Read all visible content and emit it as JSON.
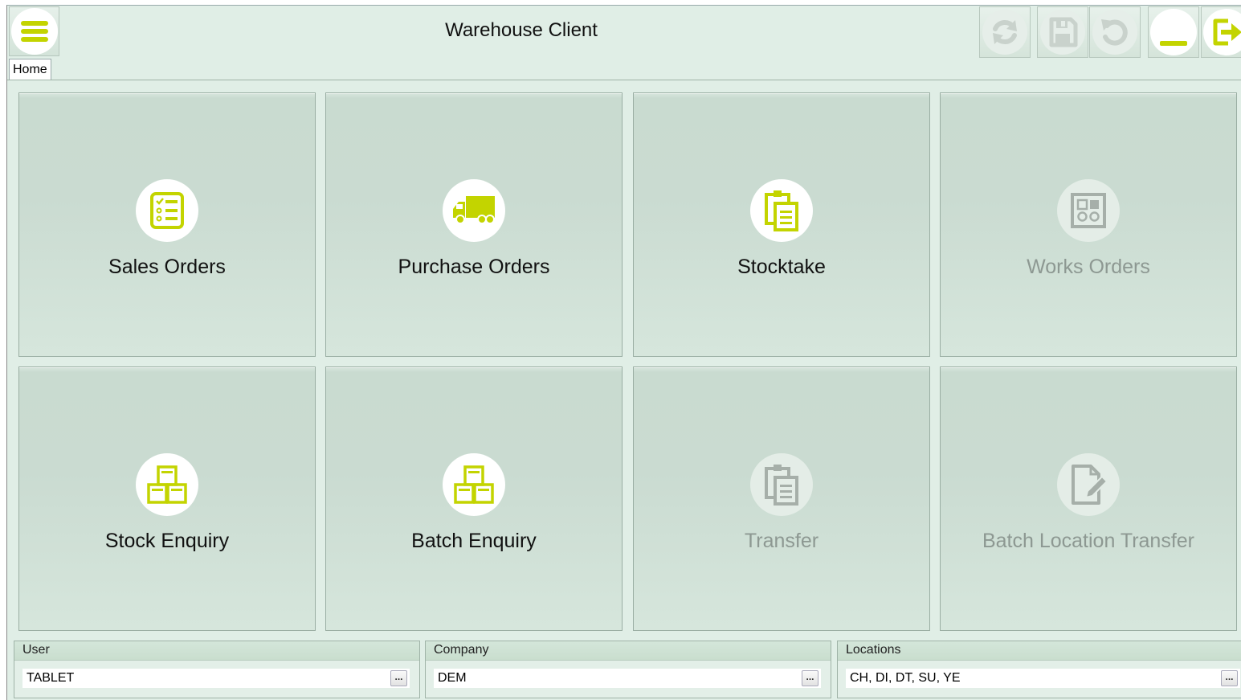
{
  "app": {
    "title": "Warehouse Client"
  },
  "tabs": [
    {
      "label": "Home"
    }
  ],
  "toolbar": [
    {
      "name": "refresh",
      "icon": "refresh-icon",
      "enabled": false
    },
    {
      "name": "save",
      "icon": "save-icon",
      "enabled": false
    },
    {
      "name": "undo",
      "icon": "undo-icon",
      "enabled": false
    },
    {
      "name": "minimize",
      "icon": "minimize-icon",
      "enabled": true
    },
    {
      "name": "exit",
      "icon": "exit-icon",
      "enabled": true
    }
  ],
  "tiles": [
    {
      "label": "Sales Orders",
      "icon": "checklist-icon",
      "enabled": true
    },
    {
      "label": "Purchase Orders",
      "icon": "truck-icon",
      "enabled": true
    },
    {
      "label": "Stocktake",
      "icon": "clipboard-icon",
      "enabled": true
    },
    {
      "label": "Works Orders",
      "icon": "works-panel-icon",
      "enabled": false
    },
    {
      "label": "Stock Enquiry",
      "icon": "boxes-icon",
      "enabled": true
    },
    {
      "label": "Batch Enquiry",
      "icon": "boxes-icon",
      "enabled": true
    },
    {
      "label": "Transfer",
      "icon": "clipboard-icon",
      "enabled": false
    },
    {
      "label": "Batch Location Transfer",
      "icon": "document-edit-icon",
      "enabled": false
    }
  ],
  "footer": {
    "user": {
      "label": "User",
      "value": "TABLET"
    },
    "company": {
      "label": "Company",
      "value": "DEM"
    },
    "locations": {
      "label": "Locations",
      "value": "CH, DI, DT, SU, YE"
    },
    "ellipsis": "..."
  },
  "colors": {
    "accent": "#c3d400",
    "disabled_icon": "#a6afa9",
    "background": "#e0eee6"
  }
}
